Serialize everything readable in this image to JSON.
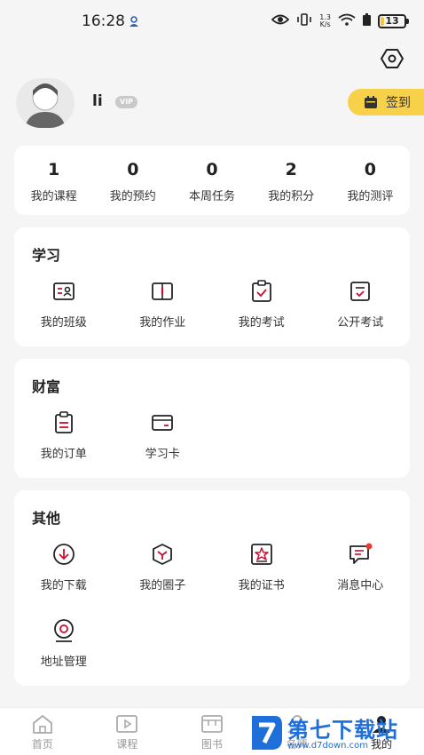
{
  "status": {
    "time": "16:28",
    "speed_value": "1.3",
    "speed_unit": "K/s",
    "battery": "13",
    "battery_level": 0.13
  },
  "header": {
    "username": "li",
    "vip": "VIP",
    "checkin": "签到"
  },
  "stats": [
    {
      "value": "1",
      "label": "我的课程"
    },
    {
      "value": "0",
      "label": "我的预约"
    },
    {
      "value": "0",
      "label": "本周任务"
    },
    {
      "value": "2",
      "label": "我的积分"
    },
    {
      "value": "0",
      "label": "我的测评"
    }
  ],
  "study": {
    "title": "学习",
    "items": [
      {
        "label": "我的班级",
        "icon": "class-icon"
      },
      {
        "label": "我的作业",
        "icon": "homework-icon"
      },
      {
        "label": "我的考试",
        "icon": "exam-icon"
      },
      {
        "label": "公开考试",
        "icon": "public-exam-icon"
      }
    ]
  },
  "wealth": {
    "title": "财富",
    "items": [
      {
        "label": "我的订单",
        "icon": "order-icon"
      },
      {
        "label": "学习卡",
        "icon": "card-icon"
      }
    ]
  },
  "other": {
    "title": "其他",
    "items": [
      {
        "label": "我的下载",
        "icon": "download-icon"
      },
      {
        "label": "我的圈子",
        "icon": "circle-icon"
      },
      {
        "label": "我的证书",
        "icon": "certificate-icon"
      },
      {
        "label": "消息中心",
        "icon": "message-icon"
      },
      {
        "label": "地址管理",
        "icon": "location-icon"
      }
    ]
  },
  "tabbar": [
    {
      "label": "首页",
      "icon": "home-icon"
    },
    {
      "label": "课程",
      "icon": "course-icon"
    },
    {
      "label": "图书",
      "icon": "book-icon"
    },
    {
      "label": "名师",
      "icon": "teacher-icon"
    },
    {
      "label": "我的",
      "icon": "profile-icon"
    }
  ],
  "watermark": {
    "text": "第七下载站",
    "url": "www.d7down.com"
  },
  "colors": {
    "accent": "#c8102e",
    "checkin": "#f7d14a",
    "page_bg": "#f5f5f5"
  }
}
